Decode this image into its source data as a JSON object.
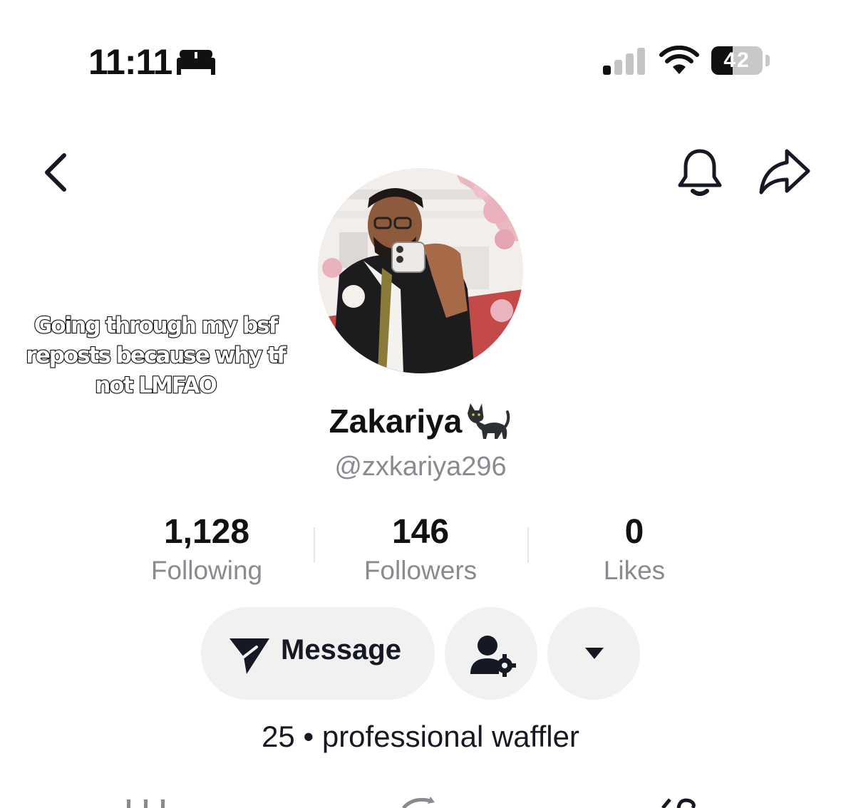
{
  "status_bar": {
    "time": "11:11",
    "focus_icon": "bed-icon",
    "signal_icon": "cellular-signal-icon",
    "wifi_icon": "wifi-icon",
    "battery_level": "42",
    "battery_fraction": 0.42
  },
  "nav": {
    "back_icon": "chevron-left-icon",
    "bell_icon": "bell-icon",
    "share_icon": "share-arrow-icon"
  },
  "overlay_caption": "Going through my bsf reposts because why tf not LMFAO",
  "profile": {
    "display_name": "Zakariya",
    "name_emoji": "🐈‍⬛",
    "handle": "@zxkariya296",
    "bio": "25 • professional waffler"
  },
  "stats": [
    {
      "value": "1,128",
      "label": "Following"
    },
    {
      "value": "146",
      "label": "Followers"
    },
    {
      "value": "0",
      "label": "Likes"
    }
  ],
  "actions": {
    "message_label": "Message",
    "message_icon": "send-plane-icon",
    "follow_settings_icon": "person-gear-icon",
    "more_icon": "caret-down-icon"
  },
  "colors": {
    "text_primary": "#161823",
    "text_secondary": "#8a8b91",
    "button_bg": "#f1f1f2"
  }
}
